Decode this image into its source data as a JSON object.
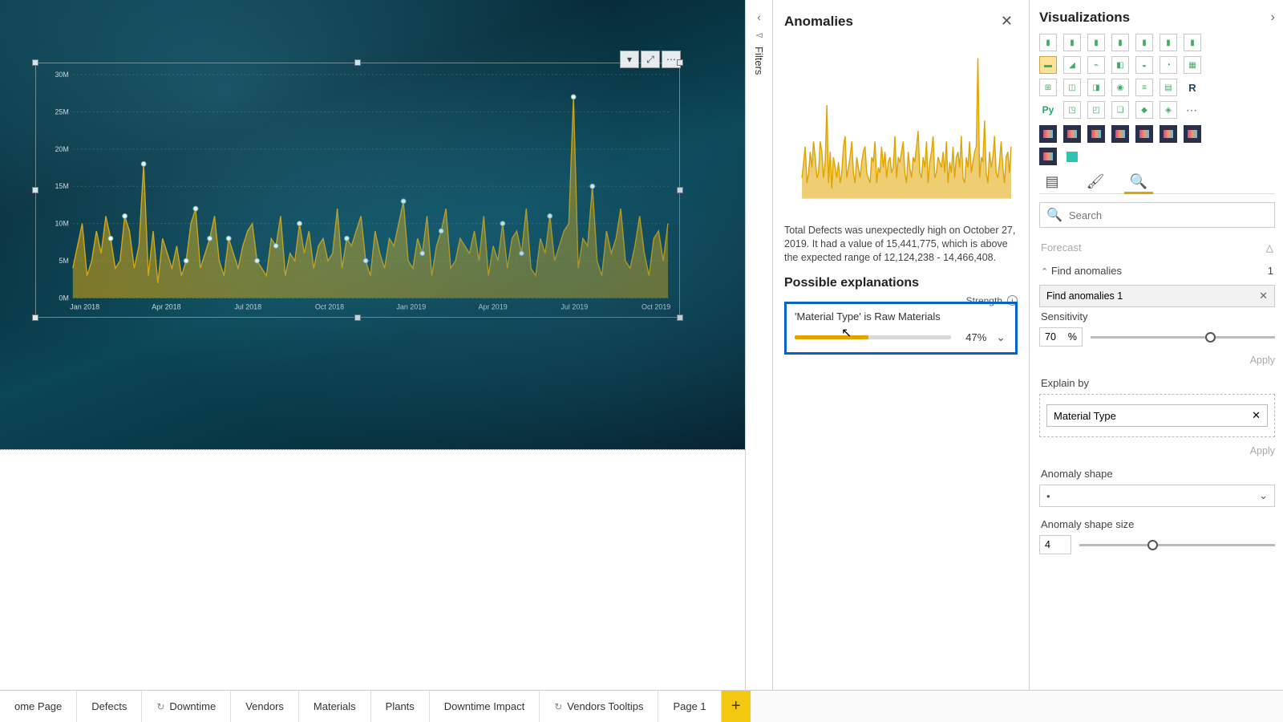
{
  "filters_label": "Filters",
  "anomalies": {
    "title": "Anomalies",
    "description": "Total Defects was unexpectedly high on October 27, 2019. It had a value of 15,441,775, which is above the expected range of 12,124,238 - 14,466,408.",
    "possible_exp_heading": "Possible explanations",
    "strength_label": "Strength",
    "explanation": {
      "text": "'Material Type' is Raw Materials",
      "percent_label": "47%",
      "percent": 47
    }
  },
  "viz": {
    "title": "Visualizations",
    "search_placeholder": "Search",
    "forecast_label": "Forecast",
    "find_anom_group": "Find anomalies",
    "find_anom_count": "1",
    "find_anom_item": "Find anomalies 1",
    "sensitivity_label": "Sensitivity",
    "sensitivity_value": "70",
    "sensitivity_unit": "%",
    "apply_label": "Apply",
    "explain_by_label": "Explain by",
    "explain_by_field": "Material Type",
    "anomaly_shape_label": "Anomaly shape",
    "anomaly_shape_value": "•",
    "anomaly_size_label": "Anomaly shape size",
    "anomaly_size_value": "4"
  },
  "page_tabs": {
    "t0": "ome Page",
    "t1": "Defects",
    "t2": "Downtime",
    "t3": "Vendors",
    "t4": "Materials",
    "t5": "Plants",
    "t6": "Downtime Impact",
    "t7": "Vendors Tooltips",
    "t8": "Page 1"
  },
  "chart_data": {
    "type": "line",
    "title": "",
    "xlabel": "",
    "ylabel": "",
    "y_ticks": [
      "0M",
      "5M",
      "10M",
      "15M",
      "20M",
      "25M",
      "30M"
    ],
    "ylim": [
      0,
      30000000
    ],
    "x_labels_visible": [
      "Jan 2018",
      "Apr 2018",
      "Jul 2018",
      "Oct 2018",
      "Jan 2019",
      "Apr 2019",
      "Jul 2019",
      "Oct 2019"
    ],
    "x_range": [
      "2018-01",
      "2019-12"
    ],
    "series_name": "Total Defects",
    "series_color": "#e0a400",
    "values_million_approx": [
      4,
      7,
      10,
      3,
      5,
      9,
      6,
      11,
      8,
      4,
      5,
      11,
      9,
      4,
      7,
      18,
      3,
      9,
      2,
      8,
      6,
      4,
      7,
      3,
      5,
      10,
      12,
      4,
      6,
      8,
      11,
      5,
      3,
      8,
      6,
      4,
      7,
      9,
      10,
      5,
      4,
      3,
      8,
      7,
      11,
      3,
      6,
      5,
      10,
      6,
      9,
      4,
      7,
      8,
      5,
      6,
      12,
      4,
      8,
      7,
      9,
      11,
      5,
      3,
      9,
      6,
      4,
      8,
      7,
      10,
      13,
      5,
      4,
      8,
      6,
      11,
      3,
      7,
      9,
      12,
      4,
      5,
      8,
      7,
      6,
      9,
      5,
      11,
      3,
      7,
      5,
      10,
      4,
      8,
      9,
      6,
      12,
      4,
      3,
      8,
      6,
      11,
      5,
      7,
      9,
      10,
      27,
      4,
      8,
      7,
      15,
      5,
      3,
      9,
      6,
      8,
      12,
      5,
      4,
      7,
      11,
      6,
      3,
      8,
      9,
      5,
      10
    ],
    "anomaly_indices_approx": [
      8,
      11,
      15,
      24,
      26,
      29,
      33,
      39,
      43,
      48,
      58,
      62,
      70,
      74,
      78,
      91,
      95,
      101,
      106,
      110
    ],
    "anomaly_marker_color": "#ffffff"
  }
}
